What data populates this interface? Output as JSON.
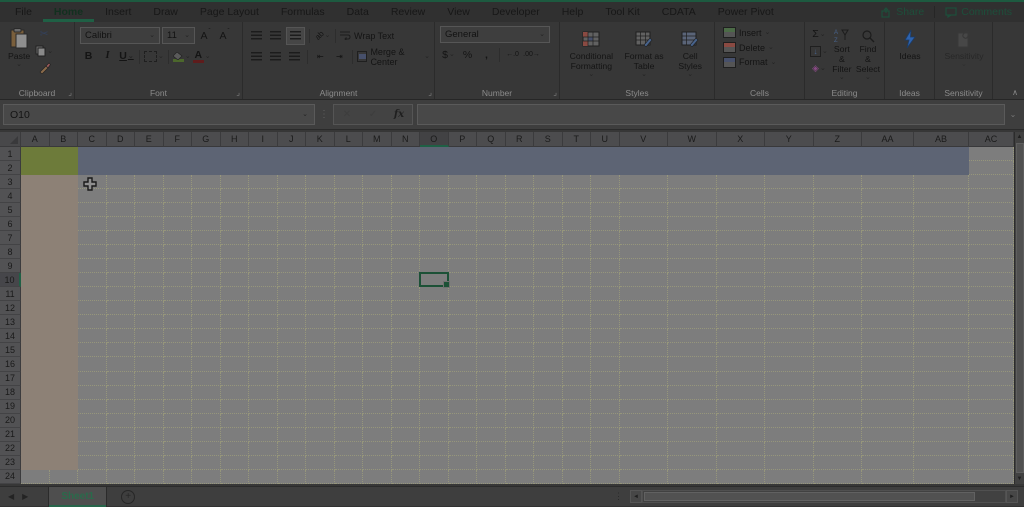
{
  "tabs": [
    {
      "label": "File",
      "active": false
    },
    {
      "label": "Home",
      "active": true
    },
    {
      "label": "Insert",
      "active": false
    },
    {
      "label": "Draw",
      "active": false
    },
    {
      "label": "Page Layout",
      "active": false
    },
    {
      "label": "Formulas",
      "active": false
    },
    {
      "label": "Data",
      "active": false
    },
    {
      "label": "Review",
      "active": false
    },
    {
      "label": "View",
      "active": false
    },
    {
      "label": "Developer",
      "active": false
    },
    {
      "label": "Help",
      "active": false
    },
    {
      "label": "Tool Kit",
      "active": false
    },
    {
      "label": "CDATA",
      "active": false
    },
    {
      "label": "Power Pivot",
      "active": false
    }
  ],
  "top_right": {
    "share": "Share",
    "comments": "Comments"
  },
  "ribbon": {
    "clipboard": {
      "label": "Clipboard",
      "paste": "Paste"
    },
    "font": {
      "label": "Font",
      "font_name": "Calibri",
      "font_size": "11",
      "bold": "B",
      "italic": "I",
      "underline": "U",
      "grow_font": "A",
      "shrink_font": "A"
    },
    "alignment": {
      "label": "Alignment",
      "orientation": "ab",
      "wrap_text": "Wrap Text",
      "merge_center": "Merge & Center"
    },
    "number": {
      "label": "Number",
      "format": "General",
      "currency": "$",
      "percent": "%",
      "comma": ",",
      "inc_decimal": "←.0",
      "dec_decimal": ".00→"
    },
    "styles": {
      "label": "Styles",
      "items": [
        "Conditional Formatting",
        "Format as Table",
        "Cell Styles"
      ]
    },
    "cells": {
      "label": "Cells",
      "items": [
        "Insert",
        "Delete",
        "Format"
      ]
    },
    "editing": {
      "label": "Editing",
      "autosum": "Σ",
      "sort_filter": "Sort & Filter",
      "find_select": "Find & Select"
    },
    "ideas": {
      "label": "Ideas",
      "button": "Ideas"
    },
    "sensitivity": {
      "label": "Sensitivity",
      "button": "Sensitivity"
    }
  },
  "formula_bar": {
    "name_box": "O10",
    "formula_value": "",
    "fx_label": "fx",
    "cancel": "✕",
    "enter": "✓"
  },
  "grid": {
    "columns": [
      "A",
      "B",
      "C",
      "D",
      "E",
      "F",
      "G",
      "H",
      "I",
      "J",
      "K",
      "L",
      "M",
      "N",
      "O",
      "P",
      "Q",
      "R",
      "S",
      "T",
      "U",
      "V",
      "W",
      "X",
      "Y",
      "Z",
      "AA",
      "AB",
      "AC"
    ],
    "row_count": 24,
    "selected_cell": "O10",
    "selected_column": "O",
    "selected_row": 10,
    "fills": [
      {
        "range": "A1:B2",
        "color": "#6d7b3a"
      },
      {
        "range": "C1:AB2",
        "color": "#5d6474"
      },
      {
        "range": "A3:B23",
        "color": "#8d8176"
      }
    ]
  },
  "sheet_bar": {
    "sheets": [
      {
        "label": "Sheet1",
        "active": true
      }
    ]
  },
  "icons": {
    "dropdown": "⌄",
    "collapse_ribbon": "∧",
    "cut": "✂",
    "sigma": "Σ",
    "fill_down": "↓",
    "clear": "◈",
    "left_nav": "◀",
    "right_nav": "▶",
    "up": "▲",
    "down": "▼",
    "scroll_left": "◄",
    "scroll_right": "►",
    "add_sheet": "+",
    "splitter": "⋮",
    "name_splitter": "⋮"
  },
  "colors": {
    "accent_green": "#1f6045",
    "selection_border": "#1c5136",
    "band_blue": "#5d6474",
    "band_green": "#6d7b3a",
    "band_tan": "#8d8176",
    "grid_bg": "#7d7d7d",
    "ideas_bolt": "#2e63ae"
  }
}
